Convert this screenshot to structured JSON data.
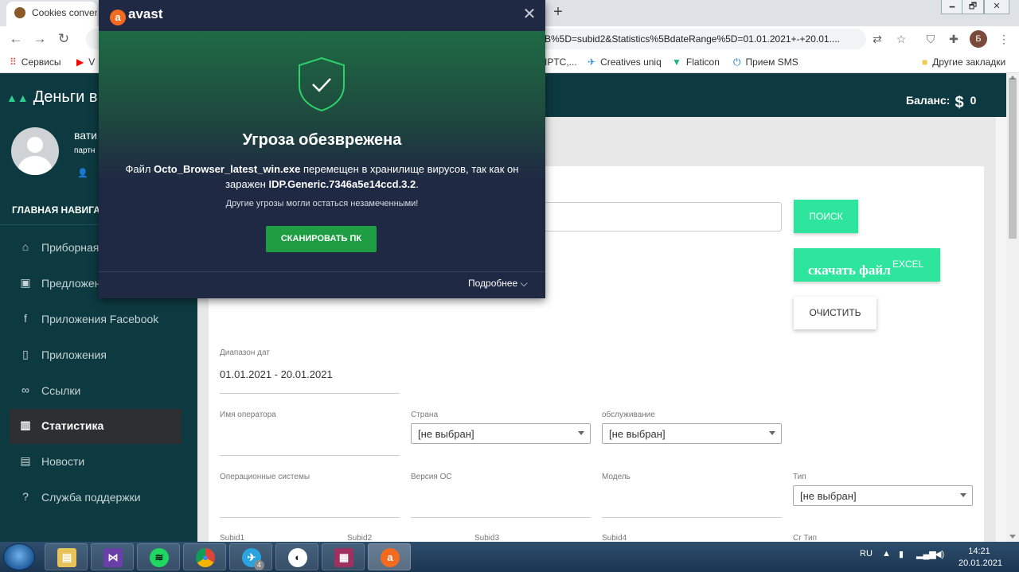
{
  "browser": {
    "tab_title": "Cookies converte",
    "new_tab": "+",
    "window_controls": [
      "🗕",
      "🗗",
      "✕"
    ],
    "url_text": "B%5D=subid2&Statistics%5BdateRange%5D=01.01.2021+-+20.01....",
    "profile_letter": "Б",
    "bookmarks": [
      {
        "label": "Сервисы",
        "icon": "apps-icon"
      },
      {
        "label": "V",
        "icon": "youtube-icon"
      },
      {
        "label": "IPTC,...",
        "icon": ""
      },
      {
        "label": "Creatives uniq",
        "icon": "creatives-icon"
      },
      {
        "label": "Flaticon",
        "icon": "flaticon-icon"
      },
      {
        "label": "Прием SMS",
        "icon": "power-icon"
      },
      {
        "label": "Другие закладки",
        "icon": "folder-icon"
      }
    ]
  },
  "app": {
    "brand": "Деньги в",
    "user_name": "вати",
    "user_role": "партн",
    "nav_heading": "ГЛАВНАЯ НАВИГА",
    "nav": [
      {
        "label": "Приборная",
        "icon": "home-icon",
        "active": false
      },
      {
        "label": "Предложен",
        "icon": "image-icon",
        "active": false
      },
      {
        "label": "Приложения Facebook",
        "icon": "facebook-icon",
        "active": false
      },
      {
        "label": "Приложения",
        "icon": "phone-icon",
        "active": false
      },
      {
        "label": "Ссылки",
        "icon": "link-icon",
        "active": false
      },
      {
        "label": "Статистика",
        "icon": "chart-icon",
        "active": true
      },
      {
        "label": "Новости",
        "icon": "news-icon",
        "active": false
      },
      {
        "label": "Служба поддержки",
        "icon": "help-icon",
        "active": false
      }
    ],
    "balance_label": "Баланс:",
    "balance_currency": "$",
    "balance_value": "0"
  },
  "filters": {
    "search_button": "ПОИСК",
    "download_button": "скачать файл",
    "download_sup": "EXCEL",
    "clear_button": "ОЧИСТИТЬ",
    "date_range_label": "Диапазон дат",
    "date_range_value": "01.01.2021 - 20.01.2021",
    "operator_label": "Имя оператора",
    "country_label": "Страна",
    "country_value": "[не выбран]",
    "service_label": "обслуживание",
    "service_value": "[не выбран]",
    "os_label": "Операционные системы",
    "os_version_label": "Версия ОС",
    "model_label": "Модель",
    "type_label": "Тип",
    "type_value": "[не выбран]",
    "subid1_label": "Subid1",
    "subid2_label": "Subid2",
    "subid3_label": "Subid3",
    "subid4_label": "Subid4",
    "cr_type_label": "Cr Тип"
  },
  "avast": {
    "logo": "avast",
    "title": "Угроза обезврежена",
    "msg_pre": "Файл ",
    "msg_file": "Octo_Browser_latest_win.exe",
    "msg_mid": " перемещен в хранилище вирусов, так как он заражен ",
    "msg_threat": "IDP.Generic.7346a5e14ccd.3.2",
    "msg_end": ".",
    "note": "Другие угрозы могли остаться незамеченными!",
    "scan_button": "СКАНИРОВАТЬ ПК",
    "more_link": "Подробнее ⌵",
    "colors": {
      "accent": "#1f9d42",
      "brand": "#f46a1f",
      "background": "#1f2943"
    }
  },
  "taskbar": {
    "lang": "RU",
    "time": "14:21",
    "date": "20.01.2021",
    "telegram_badge": "4"
  }
}
